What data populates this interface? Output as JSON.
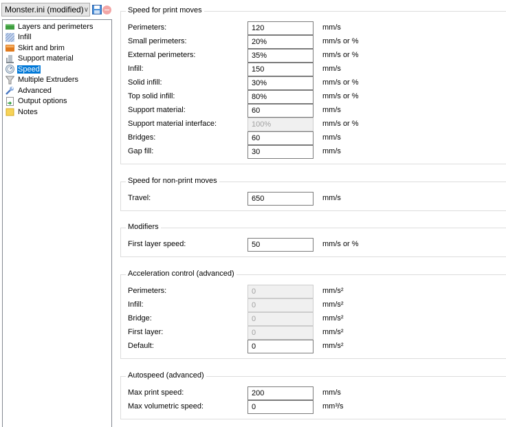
{
  "preset": {
    "name": "Monster.ini (modified)",
    "save_icon": "floppy-disk-icon",
    "delete_icon": "delete-minus-icon"
  },
  "sidebar": {
    "items": [
      {
        "label": "Layers and perimeters",
        "icon": "layers-icon",
        "selected": false
      },
      {
        "label": "Infill",
        "icon": "infill-icon",
        "selected": false
      },
      {
        "label": "Skirt and brim",
        "icon": "skirt-icon",
        "selected": false
      },
      {
        "label": "Support material",
        "icon": "support-icon",
        "selected": false
      },
      {
        "label": "Speed",
        "icon": "speedometer-icon",
        "selected": true
      },
      {
        "label": "Multiple Extruders",
        "icon": "funnel-icon",
        "selected": false
      },
      {
        "label": "Advanced",
        "icon": "wrench-icon",
        "selected": false
      },
      {
        "label": "Output options",
        "icon": "output-icon",
        "selected": false
      },
      {
        "label": "Notes",
        "icon": "note-icon",
        "selected": false
      }
    ]
  },
  "groups": [
    {
      "title": "Speed for print moves",
      "rows": [
        {
          "label": "Perimeters:",
          "value": "120",
          "unit": "mm/s",
          "disabled": false
        },
        {
          "label": "Small perimeters:",
          "value": "20%",
          "unit": "mm/s or %",
          "disabled": false
        },
        {
          "label": "External perimeters:",
          "value": "35%",
          "unit": "mm/s or %",
          "disabled": false
        },
        {
          "label": "Infill:",
          "value": "150",
          "unit": "mm/s",
          "disabled": false
        },
        {
          "label": "Solid infill:",
          "value": "30%",
          "unit": "mm/s or %",
          "disabled": false
        },
        {
          "label": "Top solid infill:",
          "value": "80%",
          "unit": "mm/s or %",
          "disabled": false
        },
        {
          "label": "Support material:",
          "value": "60",
          "unit": "mm/s",
          "disabled": false
        },
        {
          "label": "Support material interface:",
          "value": "100%",
          "unit": "mm/s or %",
          "disabled": true
        },
        {
          "label": "Bridges:",
          "value": "60",
          "unit": "mm/s",
          "disabled": false
        },
        {
          "label": "Gap fill:",
          "value": "30",
          "unit": "mm/s",
          "disabled": false
        }
      ]
    },
    {
      "title": "Speed for non-print moves",
      "rows": [
        {
          "label": "Travel:",
          "value": "650",
          "unit": "mm/s",
          "disabled": false
        }
      ]
    },
    {
      "title": "Modifiers",
      "rows": [
        {
          "label": "First layer speed:",
          "value": "50",
          "unit": "mm/s or %",
          "disabled": false
        }
      ]
    },
    {
      "title": "Acceleration control (advanced)",
      "rows": [
        {
          "label": "Perimeters:",
          "value": "0",
          "unit": "mm/s²",
          "disabled": true
        },
        {
          "label": "Infill:",
          "value": "0",
          "unit": "mm/s²",
          "disabled": true
        },
        {
          "label": "Bridge:",
          "value": "0",
          "unit": "mm/s²",
          "disabled": true
        },
        {
          "label": "First layer:",
          "value": "0",
          "unit": "mm/s²",
          "disabled": true
        },
        {
          "label": "Default:",
          "value": "0",
          "unit": "mm/s²",
          "disabled": false
        }
      ]
    },
    {
      "title": "Autospeed (advanced)",
      "rows": [
        {
          "label": "Max print speed:",
          "value": "200",
          "unit": "mm/s",
          "disabled": false
        },
        {
          "label": "Max volumetric speed:",
          "value": "0",
          "unit": "mm³/s",
          "disabled": false
        }
      ]
    }
  ]
}
